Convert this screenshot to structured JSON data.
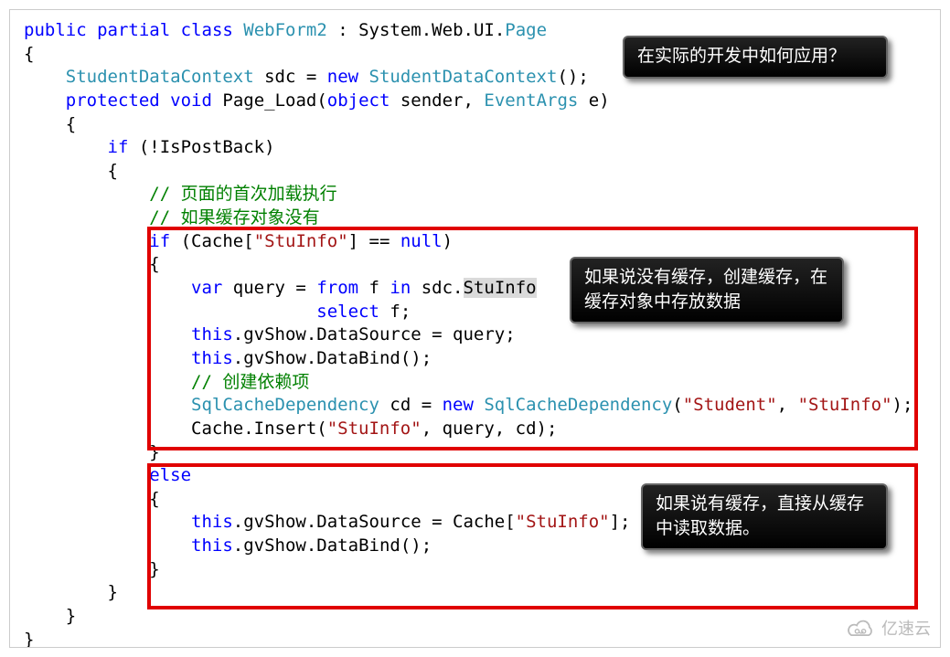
{
  "code": {
    "tokens": [
      [
        [
          "public",
          "kw"
        ],
        [
          " ",
          ""
        ],
        [
          "partial",
          "kw"
        ],
        [
          " ",
          ""
        ],
        [
          "class",
          "kw"
        ],
        [
          " ",
          ""
        ],
        [
          "WebForm2",
          "type"
        ],
        [
          " : System.Web.UI.",
          ""
        ],
        [
          "Page",
          "type"
        ]
      ],
      [
        [
          "{",
          ""
        ]
      ],
      [
        [
          "    ",
          ""
        ],
        [
          "StudentDataContext",
          "type"
        ],
        [
          " sdc = ",
          ""
        ],
        [
          "new",
          "kw"
        ],
        [
          " ",
          ""
        ],
        [
          "StudentDataContext",
          "type"
        ],
        [
          "();",
          ""
        ]
      ],
      [
        [
          "    ",
          ""
        ],
        [
          "protected",
          "kw"
        ],
        [
          " ",
          ""
        ],
        [
          "void",
          "kw"
        ],
        [
          " Page_Load(",
          ""
        ],
        [
          "object",
          "kw"
        ],
        [
          " sender, ",
          ""
        ],
        [
          "EventArgs",
          "type"
        ],
        [
          " e)",
          ""
        ]
      ],
      [
        [
          "    {",
          ""
        ]
      ],
      [
        [
          "        ",
          ""
        ],
        [
          "if",
          "kw"
        ],
        [
          " (!IsPostBack)",
          ""
        ]
      ],
      [
        [
          "        {",
          ""
        ]
      ],
      [
        [
          "            ",
          ""
        ],
        [
          "// 页面的首次加载执行",
          "cm"
        ]
      ],
      [
        [
          "            ",
          ""
        ],
        [
          "// 如果缓存对象没有",
          "cm"
        ]
      ],
      [
        [
          "            ",
          ""
        ],
        [
          "if",
          "kw"
        ],
        [
          " (Cache[",
          ""
        ],
        [
          "\"StuInfo\"",
          "str"
        ],
        [
          "] == ",
          ""
        ],
        [
          "null",
          "kw"
        ],
        [
          ")",
          ""
        ]
      ],
      [
        [
          "            {",
          ""
        ]
      ],
      [
        [
          "                ",
          ""
        ],
        [
          "var",
          "kw"
        ],
        [
          " query = ",
          ""
        ],
        [
          "from",
          "kw"
        ],
        [
          " f ",
          ""
        ],
        [
          "in",
          "kw"
        ],
        [
          " sdc.",
          ""
        ],
        [
          "StuInfo",
          "hl"
        ]
      ],
      [
        [
          "                            ",
          ""
        ],
        [
          "select",
          "kw"
        ],
        [
          " f;",
          ""
        ]
      ],
      [
        [
          "                ",
          ""
        ],
        [
          "this",
          "kw"
        ],
        [
          ".gvShow.DataSource = query;",
          ""
        ]
      ],
      [
        [
          "                ",
          ""
        ],
        [
          "this",
          "kw"
        ],
        [
          ".gvShow.DataBind();",
          ""
        ]
      ],
      [
        [
          "                ",
          ""
        ],
        [
          "// 创建依赖项",
          "cm"
        ]
      ],
      [
        [
          "                ",
          ""
        ],
        [
          "SqlCacheDependency",
          "type"
        ],
        [
          " cd = ",
          ""
        ],
        [
          "new",
          "kw"
        ],
        [
          " ",
          ""
        ],
        [
          "SqlCacheDependency",
          "type"
        ],
        [
          "(",
          ""
        ],
        [
          "\"Student\"",
          "str"
        ],
        [
          ", ",
          ""
        ],
        [
          "\"StuInfo\"",
          "str"
        ],
        [
          ");",
          ""
        ]
      ],
      [
        [
          "                Cache.Insert(",
          ""
        ],
        [
          "\"StuInfo\"",
          "str"
        ],
        [
          ", query, cd);",
          ""
        ]
      ],
      [
        [
          "            }",
          ""
        ]
      ],
      [
        [
          "            ",
          ""
        ],
        [
          "else",
          "kw"
        ]
      ],
      [
        [
          "            {",
          ""
        ]
      ],
      [
        [
          "                ",
          ""
        ],
        [
          "this",
          "kw"
        ],
        [
          ".gvShow.DataSource = Cache[",
          ""
        ],
        [
          "\"StuInfo\"",
          "str"
        ],
        [
          "];",
          ""
        ]
      ],
      [
        [
          "                ",
          ""
        ],
        [
          "this",
          "kw"
        ],
        [
          ".gvShow.DataBind();",
          ""
        ]
      ],
      [
        [
          "            }",
          ""
        ]
      ],
      [
        [
          "        }",
          ""
        ]
      ],
      [
        [
          "    }",
          ""
        ]
      ],
      [
        [
          "}",
          ""
        ]
      ]
    ]
  },
  "callouts": {
    "c1": "在实际的开发中如何应用？",
    "c2": "如果说没有缓存，创建缓存，在缓存对象中存放数据",
    "c3": "如果说有缓存，直接从缓存中读取数据。"
  },
  "watermark": "亿速云",
  "chart_data": null
}
